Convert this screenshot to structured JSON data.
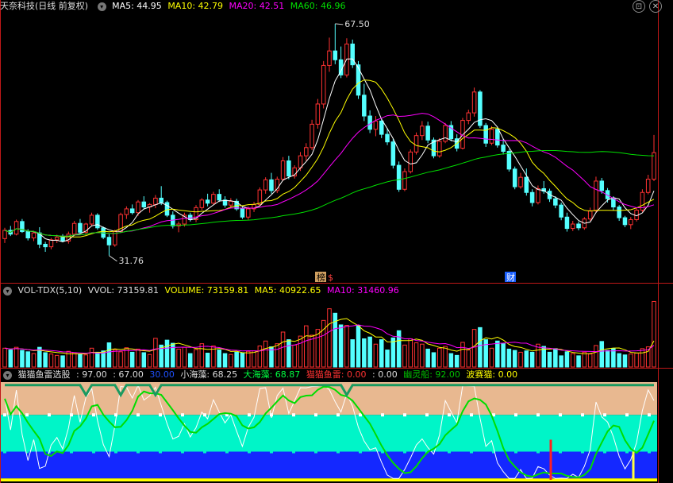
{
  "main_header": {
    "title": "天奈科技(日线 前复权)",
    "ma5": "MA5: 44.95",
    "ma10": "MA10: 42.79",
    "ma20": "MA20: 42.51",
    "ma60": "MA60: 46.96"
  },
  "vol_header": {
    "title": "VOL-TDX(5,10)",
    "vvol": "VVOL: 73159.81",
    "volume": "VOLUME: 73159.81",
    "ma5": "MA5: 40922.65",
    "ma10": "MA10: 31460.96"
  },
  "ind_header": {
    "title": "猫猫鱼雷选股",
    "v1": ": 97.00",
    "v2": ": 67.00",
    "v3": "30.00",
    "xhz": "小海藻: 68.25",
    "dhz": "大海藻: 68.87",
    "mmyl": "猫猫鱼雷: 0.00",
    "v4": ": 0.00",
    "ylc": "幽灵船: 92.00",
    "bsm": "波赛猫: 0.00"
  },
  "annotations": {
    "high": "67.50",
    "low": "31.76",
    "event_bang": "榜",
    "event_dollar": "$",
    "event_cai": "财"
  },
  "colors": {
    "up": "#ff3232",
    "down": "#54ffff",
    "ma5": "#ffffff",
    "ma10": "#ffff00",
    "ma20": "#ff00ff",
    "ma60": "#00e000",
    "panel_sep": "#c01818"
  },
  "icons": {
    "pane_collapse": "chevron-down-icon",
    "window_close": "close-icon"
  },
  "chart_data": [
    {
      "type": "candlestick",
      "title": "天奈科技(日线 前复权)",
      "ylim": [
        28,
        70
      ],
      "ohlc": [
        [
          34.5,
          36.2,
          33.8,
          35.8
        ],
        [
          35.8,
          36.5,
          34.9,
          35.2
        ],
        [
          35.2,
          37.5,
          35.0,
          37.2
        ],
        [
          37.2,
          37.6,
          35.4,
          35.6
        ],
        [
          35.6,
          36.0,
          34.2,
          34.6
        ],
        [
          34.6,
          35.6,
          34.1,
          35.4
        ],
        [
          35.4,
          36.3,
          33.0,
          33.6
        ],
        [
          33.6,
          34.0,
          32.4,
          33.2
        ],
        [
          33.2,
          34.6,
          32.8,
          34.3
        ],
        [
          34.3,
          35.1,
          33.8,
          34.7
        ],
        [
          34.7,
          35.2,
          33.9,
          34.1
        ],
        [
          34.1,
          35.6,
          33.7,
          35.2
        ],
        [
          35.2,
          37.3,
          34.9,
          36.9
        ],
        [
          36.9,
          37.6,
          35.3,
          35.5
        ],
        [
          35.5,
          37.0,
          35.1,
          36.8
        ],
        [
          36.8,
          38.6,
          36.5,
          38.2
        ],
        [
          38.2,
          38.5,
          35.9,
          36.2
        ],
        [
          36.2,
          36.4,
          34.4,
          34.7
        ],
        [
          34.7,
          35.2,
          31.8,
          33.5
        ],
        [
          33.5,
          35.9,
          33.2,
          35.6
        ],
        [
          35.6,
          38.6,
          35.4,
          38.3
        ],
        [
          38.3,
          39.6,
          37.6,
          39.2
        ],
        [
          39.2,
          39.9,
          38.3,
          38.6
        ],
        [
          38.6,
          40.6,
          38.1,
          40.3
        ],
        [
          40.3,
          41.2,
          39.2,
          39.5
        ],
        [
          39.5,
          40.1,
          38.6,
          39.9
        ],
        [
          39.9,
          41.4,
          39.3,
          40.9
        ],
        [
          40.9,
          42.8,
          39.8,
          40.2
        ],
        [
          40.2,
          40.5,
          37.9,
          38.2
        ],
        [
          38.2,
          38.8,
          36.1,
          36.5
        ],
        [
          36.5,
          37.2,
          35.5,
          36.8
        ],
        [
          36.8,
          38.6,
          36.4,
          38.2
        ],
        [
          38.2,
          38.6,
          37.2,
          37.5
        ],
        [
          37.5,
          39.8,
          37.1,
          39.4
        ],
        [
          39.4,
          40.9,
          39.0,
          40.6
        ],
        [
          40.6,
          41.6,
          39.6,
          40.1
        ],
        [
          40.1,
          41.9,
          39.9,
          41.5
        ],
        [
          41.5,
          42.3,
          40.3,
          40.6
        ],
        [
          40.6,
          41.2,
          39.4,
          39.8
        ],
        [
          39.8,
          40.9,
          39.3,
          40.4
        ],
        [
          40.4,
          40.8,
          38.9,
          39.2
        ],
        [
          39.2,
          39.5,
          37.6,
          37.9
        ],
        [
          37.9,
          39.6,
          37.5,
          39.2
        ],
        [
          39.2,
          40.3,
          38.7,
          39.9
        ],
        [
          39.9,
          42.6,
          39.6,
          42.2
        ],
        [
          42.2,
          44.2,
          41.6,
          43.8
        ],
        [
          43.8,
          44.9,
          41.6,
          42.1
        ],
        [
          42.1,
          44.3,
          41.7,
          43.9
        ],
        [
          43.9,
          47.4,
          43.6,
          46.8
        ],
        [
          46.8,
          47.6,
          43.9,
          44.4
        ],
        [
          44.4,
          46.1,
          44.0,
          45.7
        ],
        [
          45.7,
          48.2,
          45.2,
          47.6
        ],
        [
          47.6,
          49.6,
          46.8,
          48.9
        ],
        [
          48.9,
          53.3,
          48.5,
          52.6
        ],
        [
          52.6,
          56.6,
          51.9,
          55.8
        ],
        [
          55.8,
          62.6,
          55.1,
          61.9
        ],
        [
          61.9,
          66.3,
          60.9,
          64.2
        ],
        [
          64.2,
          68.5,
          62.1,
          62.8
        ],
        [
          62.8,
          64.9,
          59.9,
          60.4
        ],
        [
          60.4,
          66.2,
          60.0,
          65.3
        ],
        [
          65.3,
          66.0,
          61.5,
          62.0
        ],
        [
          62.0,
          62.6,
          56.6,
          57.2
        ],
        [
          57.2,
          59.0,
          53.1,
          53.9
        ],
        [
          53.9,
          54.8,
          51.2,
          51.8
        ],
        [
          51.8,
          53.9,
          50.7,
          53.1
        ],
        [
          53.1,
          53.6,
          50.4,
          51.0
        ],
        [
          51.0,
          52.0,
          49.3,
          49.8
        ],
        [
          49.8,
          50.3,
          45.6,
          46.1
        ],
        [
          46.1,
          46.7,
          41.9,
          42.3
        ],
        [
          42.3,
          45.6,
          42.0,
          45.1
        ],
        [
          45.1,
          48.6,
          44.8,
          48.2
        ],
        [
          48.2,
          51.3,
          47.8,
          50.8
        ],
        [
          50.8,
          53.1,
          50.1,
          52.3
        ],
        [
          52.3,
          53.0,
          49.6,
          50.1
        ],
        [
          50.1,
          50.5,
          47.2,
          47.6
        ],
        [
          47.6,
          50.4,
          47.3,
          49.9
        ],
        [
          49.9,
          52.8,
          49.6,
          52.4
        ],
        [
          52.4,
          53.1,
          49.9,
          50.3
        ],
        [
          50.3,
          51.0,
          48.3,
          48.8
        ],
        [
          48.8,
          53.6,
          48.6,
          53.2
        ],
        [
          53.2,
          54.9,
          52.6,
          54.4
        ],
        [
          54.4,
          58.4,
          53.8,
          57.7
        ],
        [
          57.7,
          58.0,
          52.0,
          52.4
        ],
        [
          52.4,
          52.8,
          49.0,
          49.6
        ],
        [
          49.6,
          52.3,
          49.3,
          51.8
        ],
        [
          51.8,
          52.2,
          48.9,
          49.3
        ],
        [
          49.3,
          50.3,
          47.8,
          48.3
        ],
        [
          48.3,
          48.6,
          45.1,
          45.5
        ],
        [
          45.5,
          45.9,
          42.3,
          42.7
        ],
        [
          42.7,
          44.9,
          42.4,
          44.2
        ],
        [
          44.2,
          45.6,
          41.3,
          41.8
        ],
        [
          41.8,
          42.3,
          39.6,
          40.2
        ],
        [
          40.2,
          42.9,
          39.9,
          42.4
        ],
        [
          42.4,
          43.6,
          41.6,
          42.0
        ],
        [
          42.0,
          42.4,
          40.3,
          40.8
        ],
        [
          40.8,
          41.2,
          39.3,
          39.8
        ],
        [
          39.8,
          40.2,
          37.4,
          37.9
        ],
        [
          37.9,
          38.6,
          35.6,
          36.1
        ],
        [
          36.1,
          37.3,
          35.7,
          36.8
        ],
        [
          36.8,
          37.2,
          35.8,
          36.2
        ],
        [
          36.2,
          37.9,
          35.9,
          37.6
        ],
        [
          37.6,
          39.4,
          37.3,
          38.9
        ],
        [
          38.9,
          44.3,
          38.6,
          43.6
        ],
        [
          43.6,
          44.1,
          41.6,
          42.1
        ],
        [
          42.1,
          42.5,
          40.2,
          40.8
        ],
        [
          40.8,
          41.2,
          39.0,
          39.5
        ],
        [
          39.5,
          39.8,
          37.3,
          37.8
        ],
        [
          37.8,
          38.1,
          36.3,
          36.7
        ],
        [
          36.7,
          37.9,
          36.0,
          37.5
        ],
        [
          37.5,
          39.4,
          37.2,
          39.0
        ],
        [
          39.0,
          42.3,
          38.7,
          41.8
        ],
        [
          41.8,
          44.6,
          41.5,
          43.9
        ],
        [
          43.9,
          50.9,
          43.6,
          48.1
        ]
      ],
      "series": [
        {
          "name": "MA5",
          "value": 44.95
        },
        {
          "name": "MA10",
          "value": 42.79
        },
        {
          "name": "MA20",
          "value": 42.51
        },
        {
          "name": "MA60",
          "value": 46.96
        }
      ],
      "annotations": [
        {
          "text": "67.50",
          "at_index": 57
        },
        {
          "text": "31.76",
          "at_index": 18
        }
      ]
    },
    {
      "type": "bar",
      "title": "VOL-TDX(5,10)",
      "ylim": [
        0,
        78000
      ],
      "values": [
        21000,
        19000,
        22000,
        18500,
        17000,
        15000,
        22000,
        16000,
        14500,
        13000,
        12500,
        17500,
        16000,
        14000,
        13500,
        21000,
        16500,
        18000,
        27000,
        19000,
        17000,
        21500,
        16500,
        20000,
        16000,
        14000,
        32000,
        24500,
        30000,
        26500,
        20000,
        22000,
        15000,
        19500,
        26000,
        15500,
        23500,
        19000,
        15000,
        14000,
        16500,
        15500,
        17500,
        18000,
        23500,
        29000,
        22500,
        26000,
        39000,
        30500,
        24500,
        34500,
        46000,
        35500,
        42000,
        52000,
        65000,
        60000,
        47000,
        46500,
        30500,
        46500,
        31500,
        33500,
        25500,
        30500,
        19000,
        32500,
        40500,
        24500,
        31500,
        27000,
        25500,
        20000,
        16000,
        21000,
        23000,
        15000,
        13000,
        27500,
        19000,
        42000,
        44000,
        30500,
        21000,
        29000,
        26000,
        20000,
        18500,
        16500,
        18000,
        16500,
        25500,
        23000,
        16500,
        20500,
        12500,
        17000,
        15000,
        12500,
        16500,
        14500,
        24000,
        28500,
        18500,
        20500,
        15000,
        13500,
        14500,
        15500,
        20500,
        22500,
        73159.81
      ],
      "series": [
        {
          "name": "VOLUME",
          "value": 73159.81
        },
        {
          "name": "MA5",
          "value": 40922.65
        },
        {
          "name": "MA10",
          "value": 31460.96
        }
      ]
    },
    {
      "type": "line",
      "title": "猫猫鱼雷选股",
      "ylim": [
        0,
        100
      ],
      "levels": [
        97,
        67,
        30
      ],
      "series": [
        {
          "name": "小海藻",
          "last": 68.25
        },
        {
          "name": "大海藻",
          "last": 68.87
        },
        {
          "name": "猫猫鱼雷",
          "last": 0
        },
        {
          "name": "幽灵船",
          "last": 92
        },
        {
          "name": "波赛猫",
          "last": 0
        }
      ]
    }
  ]
}
